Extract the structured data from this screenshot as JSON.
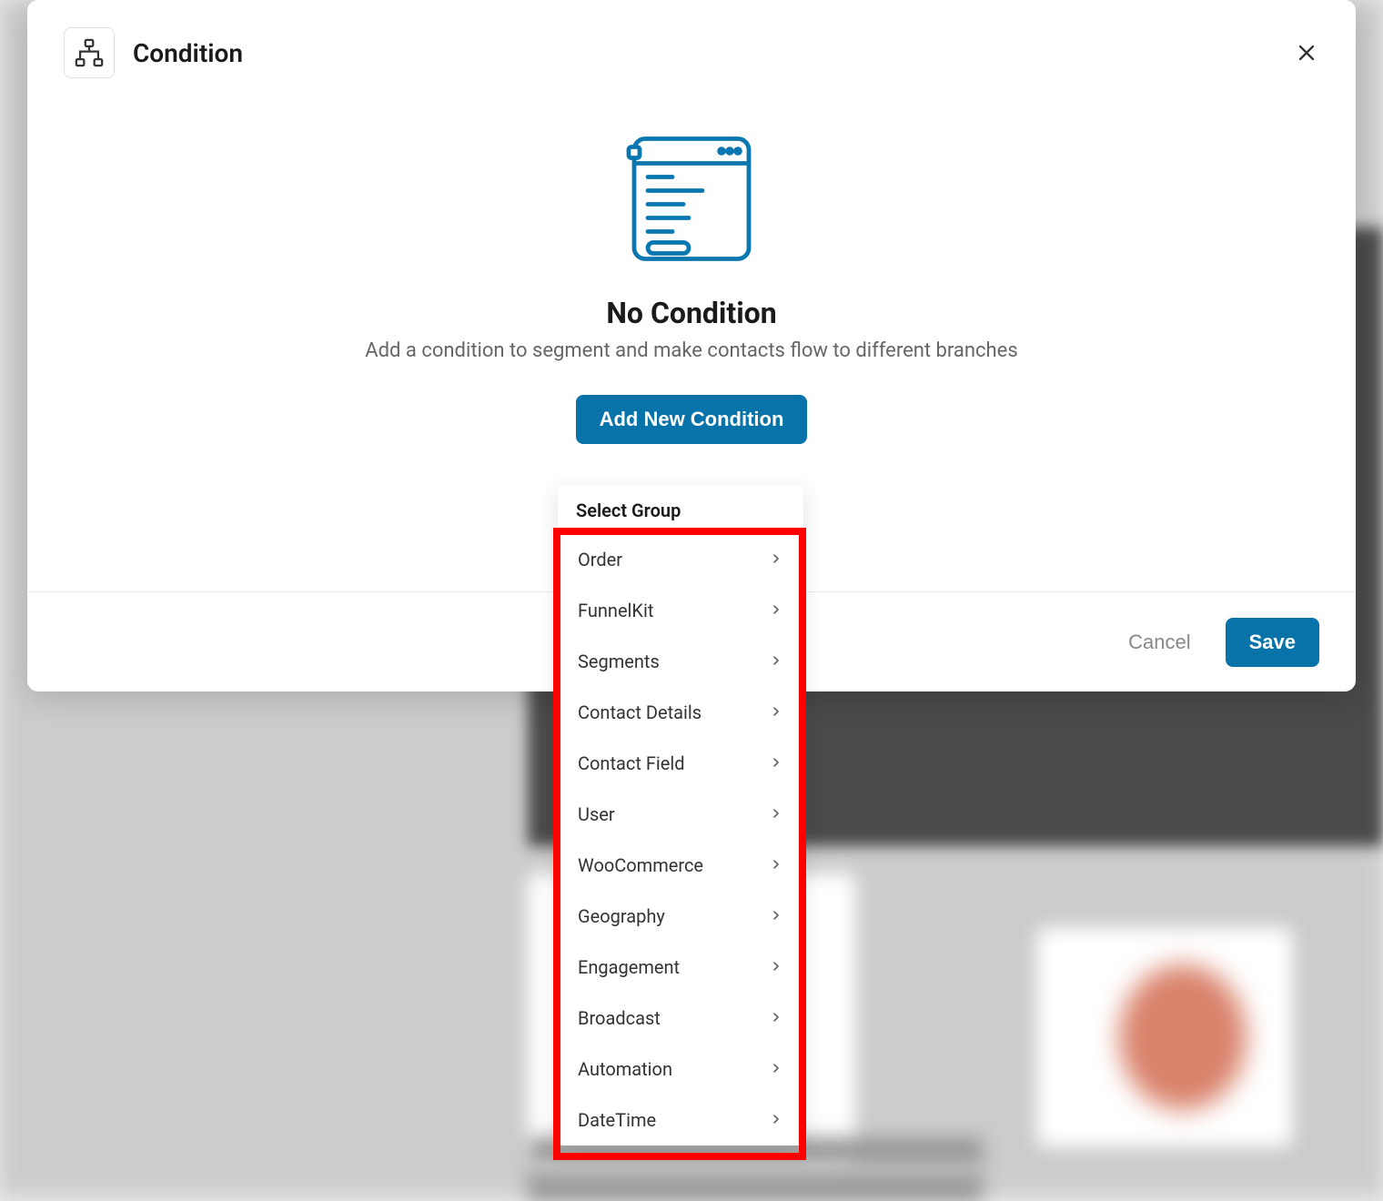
{
  "modal": {
    "title": "Condition",
    "body_title": "No Condition",
    "body_subtitle": "Add a condition to segment and make contacts flow to different branches",
    "add_button": "Add New Condition",
    "cancel_label": "Cancel",
    "save_label": "Save"
  },
  "dropdown": {
    "header": "Select Group",
    "items": [
      "Order",
      "FunnelKit",
      "Segments",
      "Contact Details",
      "Contact Field",
      "User",
      "WooCommerce",
      "Geography",
      "Engagement",
      "Broadcast",
      "Automation",
      "DateTime"
    ]
  }
}
